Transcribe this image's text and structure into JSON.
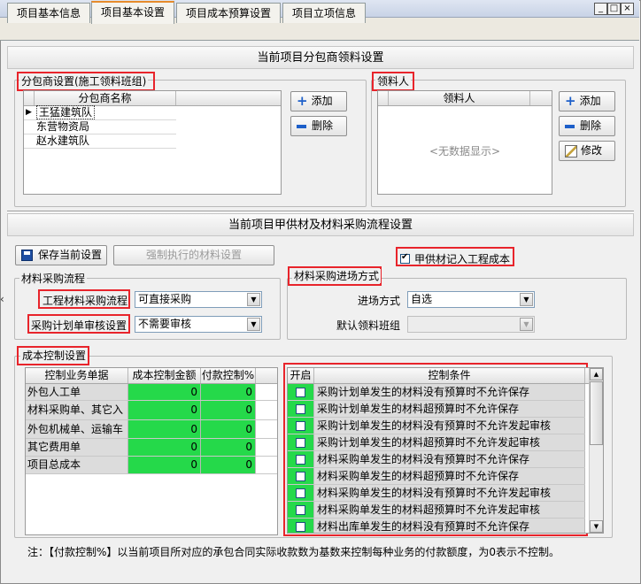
{
  "window": {
    "minimize_label": "_",
    "restore_label": "□",
    "close_label": "×"
  },
  "tabs": [
    {
      "label": "项目基本信息"
    },
    {
      "label": "项目基本设置"
    },
    {
      "label": "项目成本预算设置"
    },
    {
      "label": "项目立项信息"
    }
  ],
  "subcontract": {
    "section_title": "当前项目分包商领料设置",
    "group_label": "分包商设置(施工领料班组)",
    "column_header": "分包商名称",
    "rows": [
      "王猛建筑队",
      "东营物资局",
      "赵水建筑队"
    ],
    "row_marker": "▶",
    "add_label": "添加",
    "delete_label": "删除"
  },
  "receiver": {
    "group_label": "领料人",
    "column_header": "领料人",
    "empty_text": "<无数据显示>",
    "add_label": "添加",
    "delete_label": "删除",
    "edit_label": "修改"
  },
  "material": {
    "section_title": "当前项目甲供材及材料采购流程设置",
    "save_label": "保存当前设置",
    "force_label": "强制执行的材料设置",
    "supply_checkbox_label": "甲供材记入工程成本",
    "supply_checked": true,
    "check_mark": "✔",
    "purchase_group_label": "材料采购流程",
    "purchase_flow_label": "工程材料采购流程",
    "purchase_flow_value": "可直接采购",
    "plan_audit_label": "采购计划单审核设置",
    "plan_audit_value": "不需要审核",
    "entry_group_label": "材料采购进场方式",
    "entry_method_label": "进场方式",
    "entry_method_value": "自选",
    "default_team_label": "默认领料班组",
    "default_team_value": ""
  },
  "cost_control": {
    "group_label": "成本控制设置",
    "headers": [
      "控制业务单据",
      "成本控制金额",
      "付款控制%"
    ],
    "rows": [
      {
        "name": "外包人工单",
        "amount": "0",
        "payment": "0"
      },
      {
        "name": "材料采购单、其它入",
        "amount": "0",
        "payment": "0"
      },
      {
        "name": "外包机械单、运输车",
        "amount": "0",
        "payment": "0"
      },
      {
        "name": "其它费用单",
        "amount": "0",
        "payment": "0"
      },
      {
        "name": "项目总成本",
        "amount": "0",
        "payment": "0"
      }
    ],
    "conditions_header_enable": "开启",
    "conditions_header_condition": "控制条件",
    "conditions": [
      "采购计划单发生的材料没有预算时不允许保存",
      "采购计划单发生的材料超预算时不允许保存",
      "采购计划单发生的材料没有预算时不允许发起审核",
      "采购计划单发生的材料超预算时不允许发起审核",
      "材料采购单发生的材料没有预算时不允许保存",
      "材料采购单发生的材料超预算时不允许保存",
      "材料采购单发生的材料没有预算时不允许发起审核",
      "材料采购单发生的材料超预算时不允许发起审核",
      "材料出库单发生的材料没有预算时不允许保存"
    ]
  },
  "footer_note": "注：【付款控制%】以当前项目所对应的承包合同实际收款数为基数来控制每种业务的付款额度，为0表示不控制。",
  "side_arrow": "‹"
}
